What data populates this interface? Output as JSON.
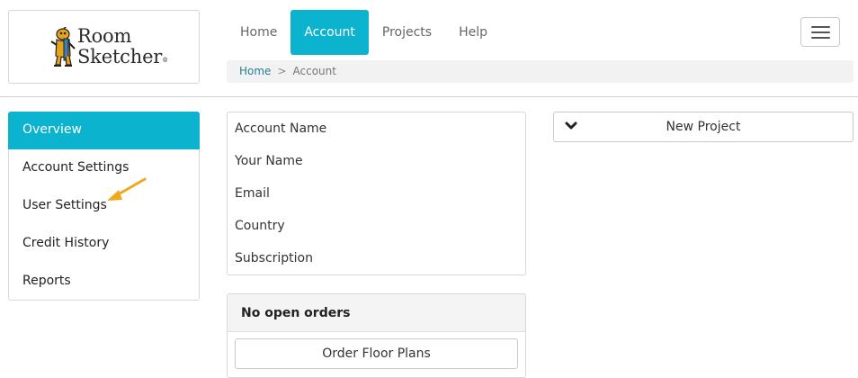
{
  "brand": {
    "line1": "Room",
    "line2": "Sketcher",
    "reg": "®"
  },
  "nav": {
    "items": [
      {
        "label": "Home"
      },
      {
        "label": "Account"
      },
      {
        "label": "Projects"
      },
      {
        "label": "Help"
      }
    ],
    "active_index": 1
  },
  "breadcrumb": {
    "home": "Home",
    "separator": ">",
    "current": "Account"
  },
  "sidebar": {
    "items": [
      {
        "label": "Overview"
      },
      {
        "label": "Account Settings"
      },
      {
        "label": "User Settings"
      },
      {
        "label": "Credit History"
      },
      {
        "label": "Reports"
      }
    ],
    "active_index": 0
  },
  "account_details": {
    "rows": [
      {
        "label": "Account Name"
      },
      {
        "label": "Your Name"
      },
      {
        "label": "Email"
      },
      {
        "label": "Country"
      },
      {
        "label": "Subscription"
      }
    ]
  },
  "orders": {
    "title": "No open orders",
    "button_label": "Order Floor Plans"
  },
  "new_project": {
    "label": "New Project"
  },
  "colors": {
    "accent": "#0bb3cf",
    "annotation_arrow": "#f0a81e",
    "link": "#2a7d96"
  }
}
